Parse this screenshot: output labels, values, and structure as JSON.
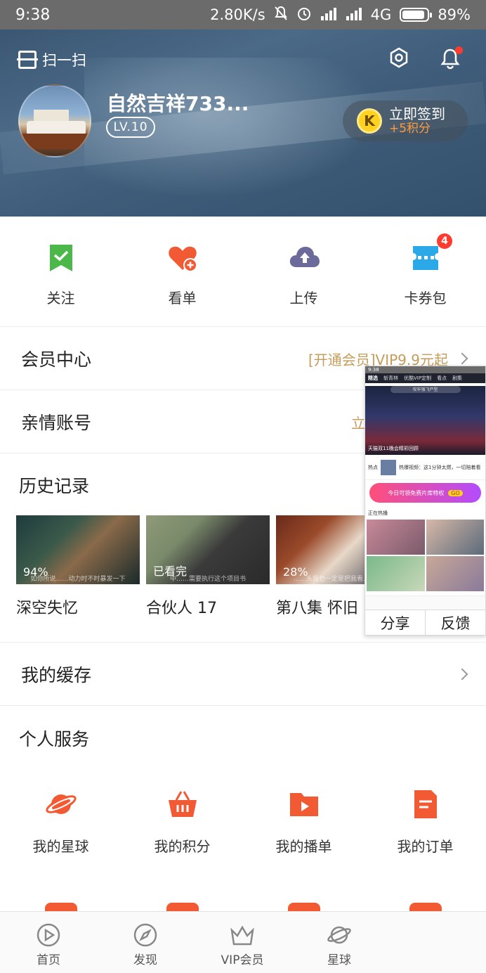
{
  "status_bar": {
    "time": "9:38",
    "speed": "2.80K/s",
    "network": "4G",
    "battery": "89%",
    "battery_level": 0.89
  },
  "header": {
    "scan_label": "扫一扫",
    "username": "自然吉祥733...",
    "level": "LV.10",
    "signin_label": "立即签到",
    "signin_reward": "+5积分"
  },
  "quick_actions": [
    {
      "label": "关注",
      "icon": "bookmark-check-icon"
    },
    {
      "label": "看单",
      "icon": "heart-plus-icon"
    },
    {
      "label": "上传",
      "icon": "cloud-upload-icon"
    },
    {
      "label": "卡券包",
      "icon": "ticket-icon",
      "badge": "4"
    }
  ],
  "member_center": {
    "title": "会员中心",
    "promo": "[开通会员]VIP9.9元起"
  },
  "family_account": {
    "title": "亲情账号",
    "promo": "立"
  },
  "history": {
    "title": "历史记录",
    "items": [
      {
        "name": "深空失忆",
        "progress": "94%",
        "caption": "如你所说……动力时不时暴发一下"
      },
      {
        "name": "合伙人 17",
        "progress": "已看完",
        "caption": "中……需要执行这个项目书"
      },
      {
        "name": "第八集 怀旧",
        "progress": "28%",
        "caption": "……头我也一定是把我看人家就"
      }
    ]
  },
  "my_cache": {
    "title": "我的缓存"
  },
  "personal_services": {
    "title": "个人服务",
    "items": [
      {
        "label": "我的星球",
        "icon": "planet-icon"
      },
      {
        "label": "我的积分",
        "icon": "basket-icon"
      },
      {
        "label": "我的播单",
        "icon": "play-folder-icon"
      },
      {
        "label": "我的订单",
        "icon": "order-doc-icon"
      }
    ]
  },
  "preview": {
    "status_time": "9:38",
    "tabs": [
      "精选",
      "斩青林",
      "优酷VIP定制",
      "看点",
      "剧集"
    ],
    "search_placeholder": "攻牢强飞严型",
    "banner_caption": "天猫双11晚会精彩回顾",
    "news_tag": "热点",
    "news_text": "热爆视频：这1分钟太燃，一切陪着看",
    "promo_text": "今日可领免费片库特权",
    "promo_go": "GO",
    "hot_label": "正在热播",
    "share_label": "分享",
    "feedback_label": "反馈"
  },
  "bottom_nav": [
    {
      "label": "首页",
      "icon": "home-play-icon"
    },
    {
      "label": "发现",
      "icon": "compass-icon"
    },
    {
      "label": "VIP会员",
      "icon": "crown-icon"
    },
    {
      "label": "星球",
      "icon": "planet-icon"
    }
  ],
  "colors": {
    "accent_orange": "#f25a33",
    "vip_gold": "#c69c5a",
    "badge_red": "#ff3b30",
    "follow_green": "#4cb84a",
    "upload_purple": "#6c6a9a",
    "ticket_blue": "#2aa8e8"
  }
}
